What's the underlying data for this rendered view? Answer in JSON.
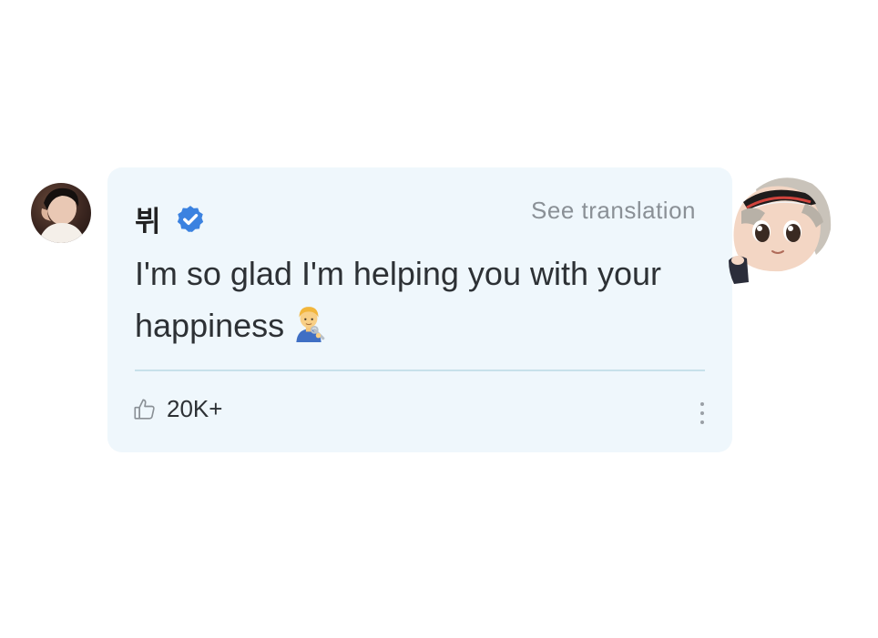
{
  "comment": {
    "author": {
      "name": "뷔",
      "verified": true,
      "avatar": "profile-photo"
    },
    "see_translation": "See translation",
    "message": "I'm so glad I'm helping you with your happiness",
    "message_emoji": "man-mechanic-emoji",
    "likes": {
      "count": "20K+",
      "icon": "thumbs-up-icon"
    },
    "more_icon": "more-vertical-icon"
  },
  "sticker": "chibi-character-sticker",
  "colors": {
    "card_background": "#eff7fc",
    "verified_badge": "#3b82e0",
    "divider": "#c7e1ea",
    "muted_text": "#8a9096"
  }
}
